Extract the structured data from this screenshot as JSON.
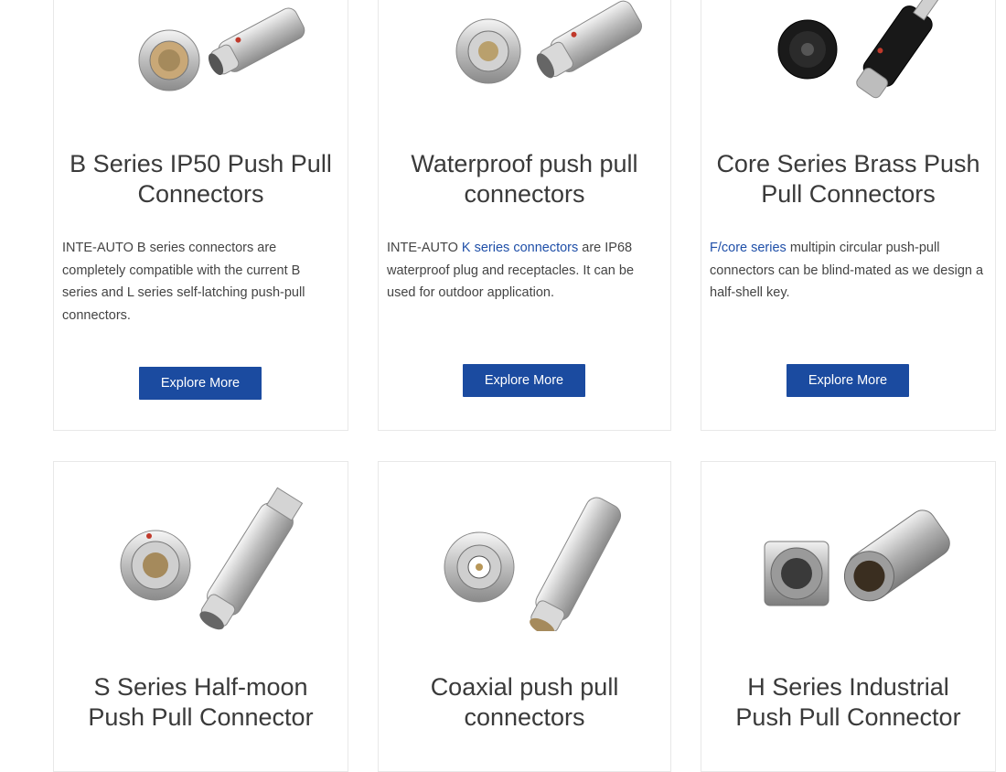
{
  "cards": [
    {
      "title_line1": "B Series IP50 Push Pull",
      "title_line2": "Connectors",
      "desc_before": "INTE-AUTO B series connectors are completely compatible with the current B series and L series self-latching push-pull connectors.",
      "desc_link": "",
      "desc_after": "",
      "button": "Explore More"
    },
    {
      "title_line1": "Waterproof push pull",
      "title_line2": "connectors",
      "desc_before": "INTE-AUTO ",
      "desc_link": "K series connectors",
      "desc_after": " are IP68 waterproof plug and receptacles. It can be used for outdoor application.",
      "button": "Explore More"
    },
    {
      "title_line1": "Core Series Brass Push",
      "title_line2": "Pull Connectors",
      "desc_before": "",
      "desc_link": "F/core series",
      "desc_after": " multipin circular push-pull connectors can be blind-mated as we design a half-shell key.",
      "button": "Explore More"
    },
    {
      "title_line1": "S Series Half-moon",
      "title_line2": "Push Pull Connector"
    },
    {
      "title_line1": "Coaxial push pull",
      "title_line2": "connectors"
    },
    {
      "title_line1": "H Series Industrial",
      "title_line2": "Push Pull Connector"
    }
  ],
  "colors": {
    "button_bg": "#1b4ba0",
    "link": "#1f4fa8",
    "card_border": "#e8e8e8"
  },
  "icons": [
    "connector-image",
    "connector-image",
    "connector-image",
    "connector-image",
    "connector-image",
    "connector-image"
  ]
}
